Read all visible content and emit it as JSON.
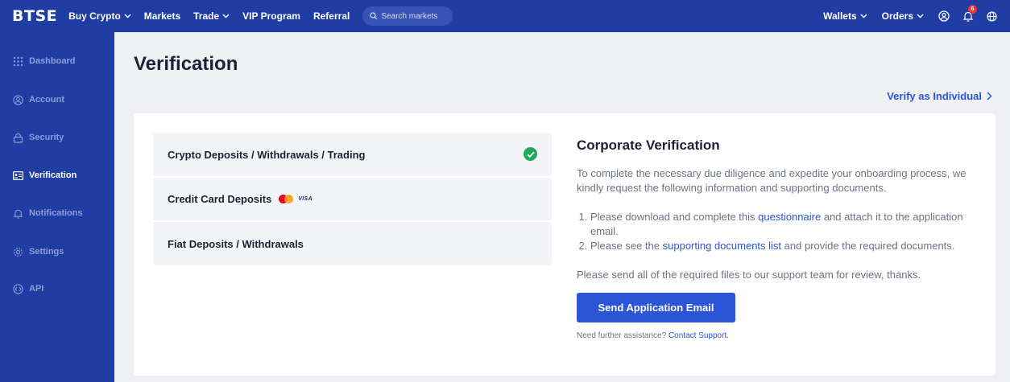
{
  "header": {
    "logo": "BTSE",
    "nav": [
      "Buy Crypto",
      "Markets",
      "Trade",
      "VIP Program",
      "Referral"
    ],
    "search_placeholder": "Search markets",
    "wallets": "Wallets",
    "orders": "Orders",
    "notification_count": "6"
  },
  "sidebar": {
    "items": [
      {
        "label": "Dashboard",
        "icon": "grid-icon"
      },
      {
        "label": "Account",
        "icon": "user-icon"
      },
      {
        "label": "Security",
        "icon": "lock-icon"
      },
      {
        "label": "Verification",
        "icon": "id-card-icon"
      },
      {
        "label": "Notifications",
        "icon": "bell-icon"
      },
      {
        "label": "Settings",
        "icon": "gear-icon"
      },
      {
        "label": "API",
        "icon": "api-icon"
      }
    ],
    "active": "Verification"
  },
  "main": {
    "title": "Verification",
    "verify_link": "Verify as Individual",
    "options": [
      {
        "label": "Crypto Deposits / Withdrawals / Trading",
        "verified": true
      },
      {
        "label": "Credit Card Deposits",
        "card_brand": "VISA"
      },
      {
        "label": "Fiat Deposits / Withdrawals"
      }
    ],
    "corporate": {
      "heading": "Corporate Verification",
      "intro": "To complete the necessary due diligence and expedite your onboarding process, we kindly request the following information and supporting documents.",
      "step1_pre": "Please download and complete this ",
      "step1_link": "questionnaire",
      "step1_post": " and attach it to the application email.",
      "step2_pre": "Please see the ",
      "step2_link": "supporting documents list",
      "step2_post": " and provide the required documents.",
      "closing": "Please send all of the required files to our support team for review, thanks.",
      "button": "Send Application Email",
      "help_text": "Need further assistance? ",
      "help_link": "Contact Support."
    }
  },
  "colors": {
    "brand": "#1f3da3",
    "accent": "#2b55d6",
    "success": "#21a75a"
  }
}
